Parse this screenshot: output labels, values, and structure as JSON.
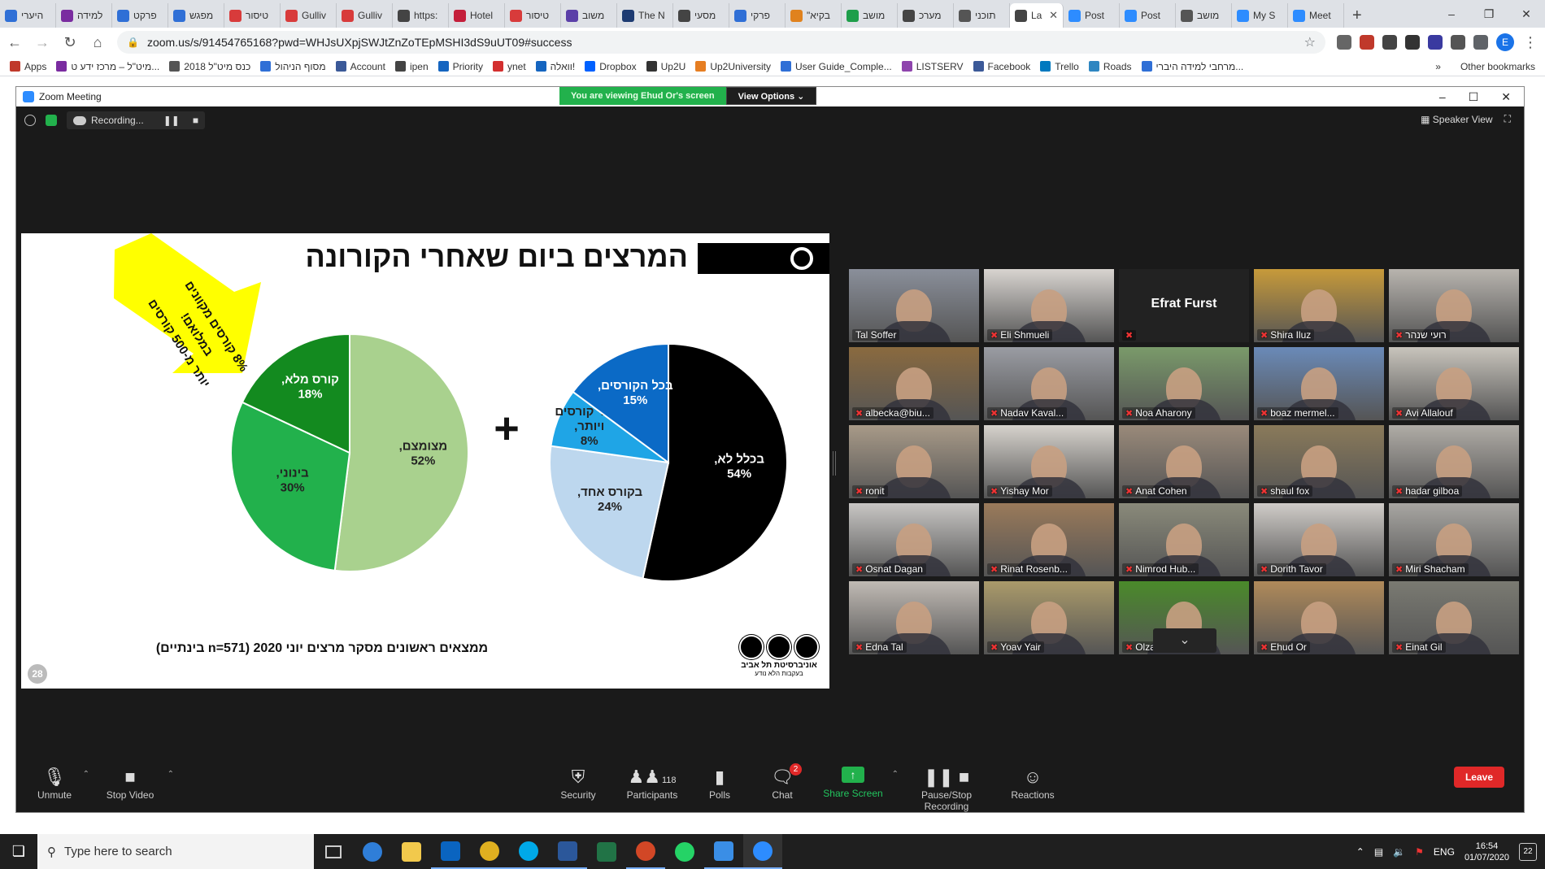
{
  "browser": {
    "tabs": [
      {
        "label": "היערי",
        "color": "#2f6fd6"
      },
      {
        "label": "למידה",
        "color": "#7a2ca0"
      },
      {
        "label": "פרקט",
        "color": "#2f6fd6"
      },
      {
        "label": "מפגש",
        "color": "#2f6fd6"
      },
      {
        "label": "טיסור",
        "color": "#d83b3b"
      },
      {
        "label": "Gulliv",
        "color": "#d83b3b"
      },
      {
        "label": "Gulliv",
        "color": "#d83b3b"
      },
      {
        "label": "https:",
        "color": "#444444"
      },
      {
        "label": "Hotel",
        "color": "#c41e3a"
      },
      {
        "label": "טיסור",
        "color": "#d83b3b"
      },
      {
        "label": "משוב",
        "color": "#5b3fa8"
      },
      {
        "label": "The N",
        "color": "#1d3b72"
      },
      {
        "label": "מסעי",
        "color": "#444444"
      },
      {
        "label": "פרקי",
        "color": "#2f6fd6"
      },
      {
        "label": "\"בקיא",
        "color": "#e0821e"
      },
      {
        "label": "מושב",
        "color": "#1e9e4a"
      },
      {
        "label": "מערכ",
        "color": "#444444"
      },
      {
        "label": "תוכני",
        "color": "#555555"
      },
      {
        "label": "La",
        "color": "#444444",
        "active": true
      },
      {
        "label": "Post",
        "color": "#2d8cff"
      },
      {
        "label": "Post",
        "color": "#2d8cff"
      },
      {
        "label": "מושב",
        "color": "#555555"
      },
      {
        "label": "My S",
        "color": "#2d8cff"
      },
      {
        "label": "Meet",
        "color": "#2d8cff"
      }
    ],
    "url": "zoom.us/s/91454765168?pwd=WHJsUXpjSWJtZnZoTEpMSHI3dS9uUT09#success",
    "bookmarks": [
      {
        "label": "Apps",
        "color": "#c0392b"
      },
      {
        "label": "מיט\"ל – מרכז ידע ט...",
        "color": "#7a2ca0"
      },
      {
        "label": "כנס מיט\"ל 2018",
        "color": "#555555"
      },
      {
        "label": "מסוף הניהול",
        "color": "#2f6fd6"
      },
      {
        "label": "Account",
        "color": "#3b5998"
      },
      {
        "label": "ipen",
        "color": "#444444"
      },
      {
        "label": "Priority",
        "color": "#1565c0"
      },
      {
        "label": "ynet",
        "color": "#d32f2f"
      },
      {
        "label": "וואלה!",
        "color": "#1565c0"
      },
      {
        "label": "Dropbox",
        "color": "#0061ff"
      },
      {
        "label": "Up2U",
        "color": "#333333"
      },
      {
        "label": "Up2University",
        "color": "#e67e22"
      },
      {
        "label": "User Guide_Comple...",
        "color": "#2f6fd6"
      },
      {
        "label": "LISTSERV",
        "color": "#8e44ad"
      },
      {
        "label": "Facebook",
        "color": "#3b5998"
      },
      {
        "label": "Trello",
        "color": "#0079bf"
      },
      {
        "label": "Roads",
        "color": "#2e86c1"
      },
      {
        "label": "מרחבי למידה היברי...",
        "color": "#2f6fd6"
      }
    ],
    "other_bookmarks": "Other bookmarks",
    "overflow": "»"
  },
  "zoom": {
    "window_title": "Zoom Meeting",
    "viewing_banner": "You are viewing Ehud Or's screen",
    "view_options": "View Options",
    "recording": "Recording...",
    "speaker_view": "Speaker View",
    "participants_count": "118",
    "chat_badge": "2",
    "toolbar": {
      "unmute": "Unmute",
      "stop_video": "Stop Video",
      "security": "Security",
      "participants": "Participants",
      "polls": "Polls",
      "chat": "Chat",
      "share_screen": "Share Screen",
      "pause_stop_recording": "Pause/Stop Recording",
      "reactions": "Reactions",
      "leave": "Leave"
    },
    "participants": [
      {
        "name": "Tal Soffer",
        "bg": "#8a8f9a",
        "active": true
      },
      {
        "name": "Eli Shmueli",
        "bg": "#d8d4d0"
      },
      {
        "name": "Efrat Furst",
        "bg": "#222222",
        "no_video": true
      },
      {
        "name": "Shira Iluz",
        "bg": "#c79a3a"
      },
      {
        "name": "רועי שנהר",
        "bg": "#b8b4ae"
      },
      {
        "name": "albecka@biu...",
        "bg": "#8a6a3f"
      },
      {
        "name": "Nadav Kaval...",
        "bg": "#9a9ca3"
      },
      {
        "name": "Noa Aharony",
        "bg": "#7a9a6a"
      },
      {
        "name": "boaz mermel...",
        "bg": "#6a8ab8"
      },
      {
        "name": "Avi Allalouf",
        "bg": "#c8c4bc"
      },
      {
        "name": "ronit",
        "bg": "#a89a88"
      },
      {
        "name": "Yishay Mor",
        "bg": "#d6d2cc"
      },
      {
        "name": "Anat Cohen",
        "bg": "#9a8a7a"
      },
      {
        "name": "shaul fox",
        "bg": "#8a7a5a"
      },
      {
        "name": "hadar gilboa",
        "bg": "#b0aca6"
      },
      {
        "name": "Osnat Dagan",
        "bg": "#c8c6c4"
      },
      {
        "name": "Rinat Rosenb...",
        "bg": "#9a7a5a"
      },
      {
        "name": "Nimrod Hub...",
        "bg": "#8a8a7a"
      },
      {
        "name": "Dorith Tavor",
        "bg": "#d0ccc8"
      },
      {
        "name": "Miri Shacham",
        "bg": "#a8a6a2"
      },
      {
        "name": "Edna Tal",
        "bg": "#c0bab4"
      },
      {
        "name": "Yoav Yair",
        "bg": "#aa9a6a"
      },
      {
        "name": "Olzan Goldst...",
        "bg": "#4a8a2a"
      },
      {
        "name": "Ehud Or",
        "bg": "#b08a5a"
      },
      {
        "name": "Einat Gil",
        "bg": "#7a7a72"
      }
    ]
  },
  "slide": {
    "title": "המרצים ביום שאחרי הקורונה",
    "arrow_line1": "8% קורסים מקוונים",
    "arrow_line2": "במלואם!",
    "arrow_line3": "יותר מ-500 קורסים",
    "footer": "ממצאים ראשונים מסקר מרצים יוני 2020 (n=571 בינתיים)",
    "page_number": "28",
    "plus_sign": "+",
    "university_name": "אוניברסיטת תל אביב",
    "university_sub": "בעקבות הלא נודע"
  },
  "chart_data": [
    {
      "type": "pie",
      "slices": [
        {
          "label": "מצומצם,",
          "value": 52,
          "color": "#a9d18e"
        },
        {
          "label": "בינוני,",
          "value": 30,
          "color": "#22b14c"
        },
        {
          "label": "קורס מלא,",
          "value": 18,
          "color": "#138a1f"
        }
      ]
    },
    {
      "type": "pie",
      "slices": [
        {
          "label": "בכלל לא,",
          "value": 54,
          "color": "#000000"
        },
        {
          "label": "בקורס אחד,",
          "value": 24,
          "color": "#bdd7ee"
        },
        {
          "label": "בשני קורסים ויותר,",
          "value": 8,
          "color": "#1fa5e6"
        },
        {
          "label": "בכל הקורסים,",
          "value": 15,
          "color": "#0b6ac6"
        }
      ]
    }
  ],
  "taskbar": {
    "search_placeholder": "Type here to search",
    "language": "ENG",
    "time": "16:54",
    "date": "01/07/2020",
    "notifications": "22"
  }
}
